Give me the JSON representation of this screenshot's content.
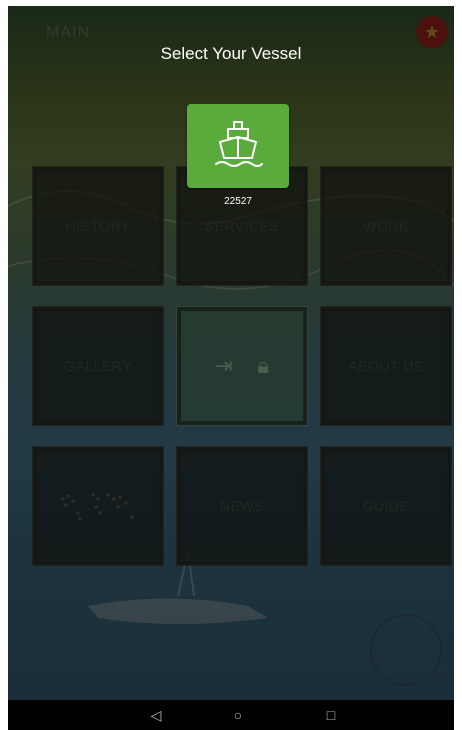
{
  "header": {
    "title": "MAIN"
  },
  "menu": {
    "history": "HISTORY",
    "services": "SERVICES",
    "work": "WORK",
    "gallery": "GALLERY",
    "about": "ABOUT US",
    "news": "NEWS",
    "guide": "GUIDE"
  },
  "dialog": {
    "title": "Select Your Vessel",
    "vessels": [
      {
        "id": "22527"
      }
    ]
  },
  "colors": {
    "vessel_tile": "#5aab3c",
    "overlay": "rgba(0,0,0,0.45)"
  }
}
